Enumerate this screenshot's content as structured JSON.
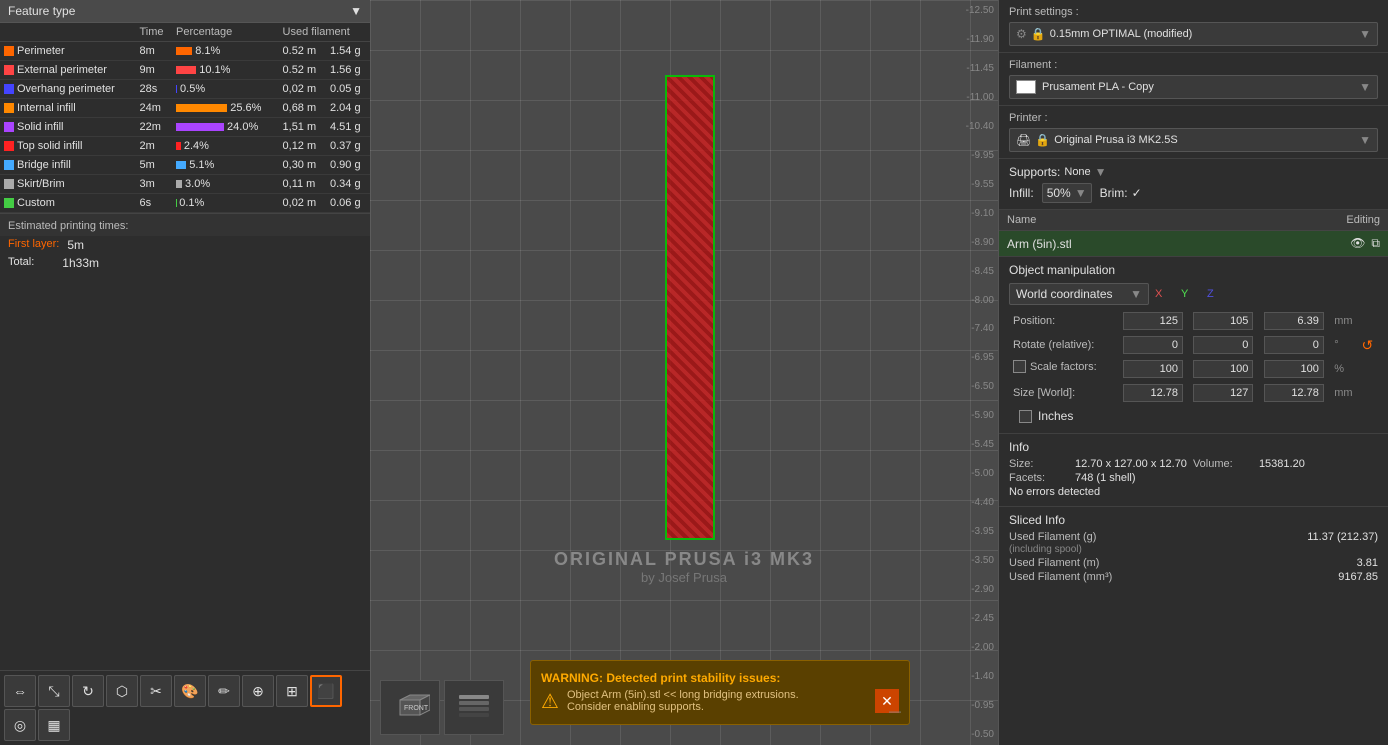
{
  "left_panel": {
    "feature_type_label": "Feature type",
    "dropdown_arrow": "▼",
    "table_headers": [
      "",
      "Time",
      "Percentage",
      "Used filament",
      ""
    ],
    "features": [
      {
        "name": "Perimeter",
        "color": "#ff6600",
        "time": "8m",
        "pct": "8.1%",
        "dist": "0.52 m",
        "weight": "1.54 g"
      },
      {
        "name": "External perimeter",
        "color": "#ff4444",
        "time": "9m",
        "pct": "10.1%",
        "dist": "0.52 m",
        "weight": "1.56 g"
      },
      {
        "name": "Overhang perimeter",
        "color": "#4444ff",
        "time": "28s",
        "pct": "0.5%",
        "dist": "0,02 m",
        "weight": "0.05 g"
      },
      {
        "name": "Internal infill",
        "color": "#ff8800",
        "time": "24m",
        "pct": "25.6%",
        "dist": "0,68 m",
        "weight": "2.04 g"
      },
      {
        "name": "Solid infill",
        "color": "#aa44ff",
        "time": "22m",
        "pct": "24.0%",
        "dist": "1,51 m",
        "weight": "4.51 g"
      },
      {
        "name": "Top solid infill",
        "color": "#ff2222",
        "time": "2m",
        "pct": "2.4%",
        "dist": "0,12 m",
        "weight": "0.37 g"
      },
      {
        "name": "Bridge infill",
        "color": "#44aaff",
        "time": "5m",
        "pct": "5.1%",
        "dist": "0,30 m",
        "weight": "0.90 g"
      },
      {
        "name": "Skirt/Brim",
        "color": "#aaaaaa",
        "time": "3m",
        "pct": "3.0%",
        "dist": "0,11 m",
        "weight": "0.34 g"
      },
      {
        "name": "Custom",
        "color": "#44cc44",
        "time": "6s",
        "pct": "0.1%",
        "dist": "0,02 m",
        "weight": "0.06 g"
      }
    ],
    "estimated_label": "Estimated printing times:",
    "first_layer_label": "First layer:",
    "first_layer_value": "5m",
    "total_label": "Total:",
    "total_value": "1h33m",
    "toolbar_tools": [
      "move",
      "scale",
      "rotate",
      "place-face",
      "cut",
      "layer-paint",
      "support-paint",
      "seam-paint",
      "fdm-support",
      "boolean",
      "orient",
      "arrange",
      "slice",
      "export"
    ]
  },
  "viewport": {
    "printer_name": "ORIGINAL PRUSA i3 MK3",
    "printer_sub": "by Josef Prusa",
    "y_scale": [
      "-12.50",
      "-11.90",
      "-11.45",
      "-11.00",
      "-10.40",
      "-9.95",
      "-9.55",
      "-9.10",
      "-8.90",
      "-8.45",
      "-8.00",
      "-7.40",
      "-6.95",
      "-6.50",
      "-5.90",
      "-5.45",
      "-5.00",
      "-4.40",
      "-3.95",
      "-3.50",
      "-2.90",
      "-2.45",
      "-2.00",
      "-1.40",
      "-0.95",
      "-0.50"
    ]
  },
  "warning": {
    "title": "WARNING:",
    "line1": "Detected print stability issues:",
    "line2": "Object Arm (5in).stl << long bridging extrusions.",
    "line3": "Consider enabling supports."
  },
  "right_panel": {
    "print_settings_label": "Print settings :",
    "print_profile": "0.15mm OPTIMAL (modified)",
    "filament_label": "Filament :",
    "filament_value": "Prusament PLA - Copy",
    "printer_label": "Printer :",
    "printer_value": "Original Prusa i3 MK2.5S",
    "supports_label": "Supports:",
    "supports_value": "None",
    "infill_label": "Infill:",
    "infill_value": "50%",
    "brim_label": "Brim:",
    "brim_checked": true,
    "obj_name_header": "Name",
    "obj_editing_header": "Editing",
    "object_name": "Arm (5in).stl",
    "object_manipulation_title": "Object manipulation",
    "coord_system": "World coordinates",
    "axis_x": "X",
    "axis_y": "Y",
    "axis_z": "Z",
    "position_label": "Position:",
    "pos_x": "125",
    "pos_y": "105",
    "pos_z": "6.39",
    "pos_unit": "mm",
    "rotate_label": "Rotate (relative):",
    "rot_x": "0",
    "rot_y": "0",
    "rot_z": "0",
    "rot_unit": "°",
    "scale_label": "Scale factors:",
    "scale_x": "100",
    "scale_y": "100",
    "scale_z": "100",
    "scale_unit": "%",
    "size_label": "Size [World]:",
    "size_x": "12.78",
    "size_y": "127",
    "size_z": "12.78",
    "size_unit": "mm",
    "inches_label": "Inches",
    "info_title": "Info",
    "size_info_label": "Size:",
    "size_info_value": "12.70 x 127.00 x 12.70",
    "volume_label": "Volume:",
    "volume_value": "15381.20",
    "facets_label": "Facets:",
    "facets_value": "748 (1 shell)",
    "errors_value": "No errors detected",
    "sliced_title": "Sliced Info",
    "fil_g_label": "Used Filament (g)",
    "fil_g_value": "11.37 (212.37)",
    "fil_g_note": "(including spool)",
    "fil_m_label": "Used Filament (m)",
    "fil_m_value": "3.81",
    "fil_mm3_label": "Used Filament (mm³)",
    "fil_mm3_value": "9167.85"
  }
}
